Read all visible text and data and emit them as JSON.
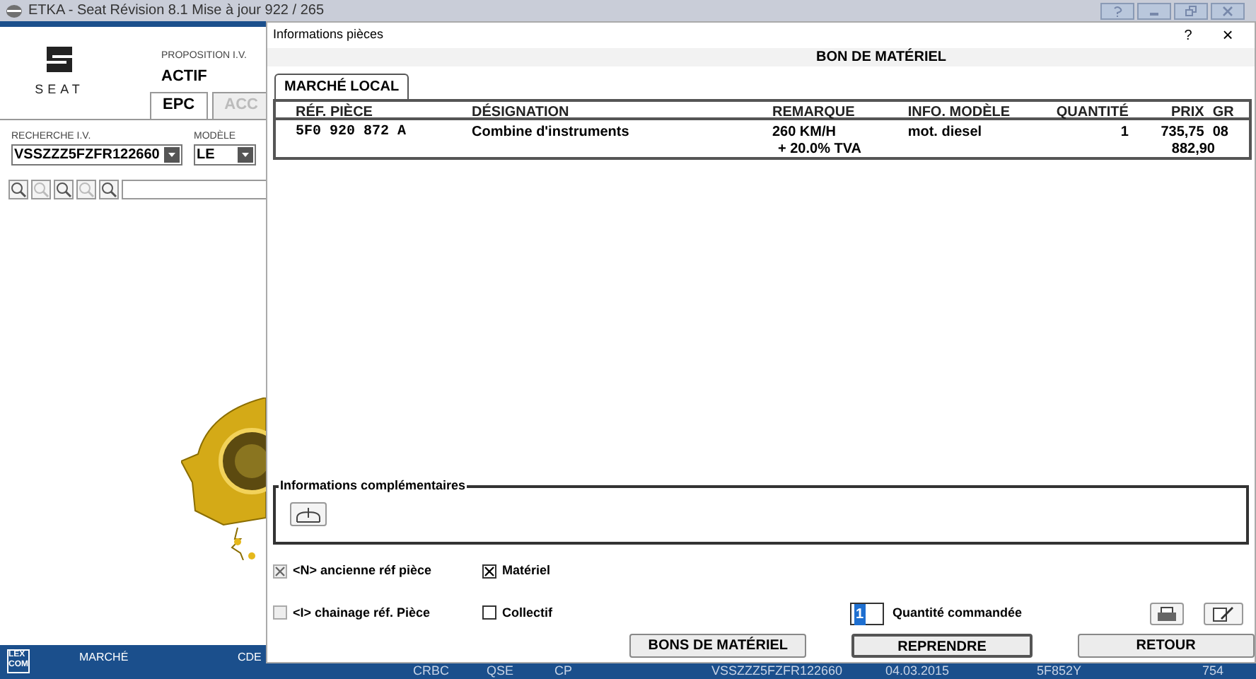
{
  "app": {
    "title": "ETKA - Seat Révision 8.1 Mise à jour 922 / 265",
    "logo_text": "SEAT",
    "proposition_label": "PROPOSITION I.V.",
    "proposition_value": "ACTIF",
    "tabs": [
      {
        "label": "EPC",
        "selected": true
      },
      {
        "label": "ACC",
        "selected": false
      }
    ],
    "search": {
      "label": "RECHERCHE I.V.",
      "value": "VSSZZZ5FZFR122660"
    },
    "model": {
      "label": "MODÈLE",
      "value": "LE"
    },
    "status_bar": {
      "logo_text": "LEX COM",
      "labels": [
        "MARCHÉ",
        "CDE"
      ],
      "values": [
        "CRBC",
        "QSE",
        "CP",
        "VSSZZZ5FZFR122660",
        "04.03.2015",
        "5F852Y",
        "754"
      ]
    }
  },
  "dialog": {
    "title": "Informations pièces",
    "help": "?",
    "close": "×",
    "heading": "BON DE MATÉRIEL",
    "tabs": [
      {
        "label": "MARCHÉ LOCAL",
        "selected": true
      }
    ],
    "table": {
      "columns": [
        "RÉF. PIÈCE",
        "DÉSIGNATION",
        "REMARQUE",
        "INFO. MODÈLE",
        "QUANTITÉ",
        "PRIX",
        "GR"
      ],
      "rows": [
        [
          "5F0 920 872 A",
          "Combine d'instruments",
          "260 KM/H",
          "mot. diesel",
          "1",
          "735,75",
          "08"
        ]
      ],
      "tax_label": "+ 20.0% TVA",
      "total": "882,90"
    },
    "info_group": {
      "title": "Informations complémentaires"
    },
    "checkboxes": [
      {
        "label": "<N> ancienne réf pièce",
        "checked": true,
        "disabled": true
      },
      {
        "label": "Matériel",
        "checked": true,
        "disabled": false
      },
      {
        "label": "<I> chainage réf. Pièce",
        "checked": false,
        "disabled": true
      },
      {
        "label": "Collectif",
        "checked": false,
        "disabled": false
      }
    ],
    "quantity": {
      "value": "1",
      "label": "Quantité commandée"
    },
    "buttons": [
      "BONS DE MATÉRIEL",
      "REPRENDRE",
      "RETOUR"
    ]
  }
}
